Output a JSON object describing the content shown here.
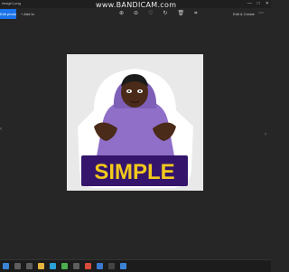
{
  "window": {
    "filename": "image1.png",
    "watermark": "www.BANDICAM.com",
    "controls": [
      "—",
      "□",
      "✕"
    ]
  },
  "toolbar": {
    "edit_label": "Edit photo",
    "add_to_label": "+ Add to",
    "icons": [
      "zoom-in-icon",
      "zoom-out-icon",
      "heart-icon",
      "rotate-icon",
      "delete-icon",
      "crop-icon"
    ],
    "edit_create_label": "Edit & Create",
    "more_label": "⋯"
  },
  "image": {
    "sticker_text": "SIMPLE",
    "banner_color": "#35156b",
    "text_color": "#f2c91c",
    "hoodie_color": "#8f6fc7"
  },
  "nav": {
    "prev": "‹",
    "next": "›"
  },
  "taskbar": {
    "time": "",
    "icons": [
      {
        "name": "windows-start-icon",
        "color": "#3a83d6"
      },
      {
        "name": "search-icon",
        "color": "#5d5d5d"
      },
      {
        "name": "task-view-icon",
        "color": "#5d5d5d"
      },
      {
        "name": "folder-icon",
        "color": "#e7b53d"
      },
      {
        "name": "edge-icon",
        "color": "#2aa0d8"
      },
      {
        "name": "chrome-icon",
        "color": "#4caf50"
      },
      {
        "name": "store-icon",
        "color": "#5d5d5d"
      },
      {
        "name": "app-icon",
        "color": "#d64b3b"
      },
      {
        "name": "mail-icon",
        "color": "#3b78d1"
      },
      {
        "name": "terminal-icon",
        "color": "#444444"
      },
      {
        "name": "photos-icon",
        "color": "#3a83d6"
      }
    ]
  }
}
